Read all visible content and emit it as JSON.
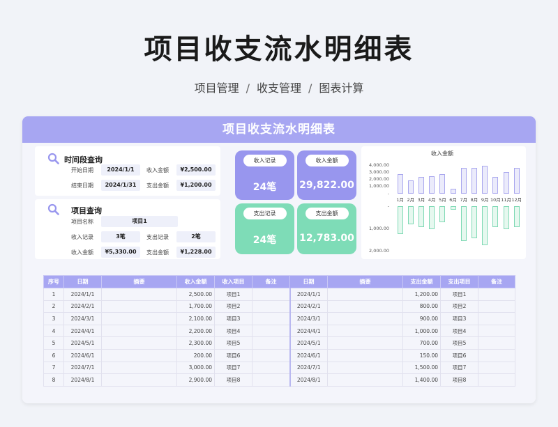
{
  "header": {
    "title": "项目收支流水明细表",
    "breadcrumb": [
      "项目管理",
      "收支管理",
      "图表计算"
    ]
  },
  "card_title": "项目收支流水明细表",
  "time_query": {
    "title": "时间段查询",
    "start_label": "开始日期",
    "start_value": "2024/1/1",
    "income_label": "收入金额",
    "income_value": "¥2,500.00",
    "end_label": "结束日期",
    "end_value": "2024/1/31",
    "expense_label": "支出金额",
    "expense_value": "¥1,200.00"
  },
  "project_query": {
    "title": "项目查询",
    "name_label": "项目名称",
    "name_value": "项目1",
    "income_records_label": "收入记录",
    "income_records_value": "3笔",
    "expense_records_label": "支出记录",
    "expense_records_value": "2笔",
    "income_amount_label": "收入金额",
    "income_amount_value": "¥5,330.00",
    "expense_amount_label": "支出金额",
    "expense_amount_value": "¥1,228.00"
  },
  "stats": {
    "income_records": {
      "label": "收入记录",
      "value": "24笔"
    },
    "income_amount": {
      "label": "收入金额",
      "value": "29,822.00"
    },
    "expense_records": {
      "label": "支出记录",
      "value": "24笔"
    },
    "expense_amount": {
      "label": "支出金额",
      "value": "12,783.00"
    }
  },
  "colors": {
    "accent": "#a7a6f2",
    "purple_card": "#9896ee",
    "green_card": "#7edcb7"
  },
  "chart_data": {
    "type": "bar",
    "title": "收入金额",
    "categories": [
      "1月",
      "2月",
      "3月",
      "4月",
      "5月",
      "6月",
      "7月",
      "8月",
      "9月",
      "10月",
      "11月",
      "12月"
    ],
    "series": [
      {
        "values": [
          2500,
          1700,
          2100,
          2200,
          2500,
          600,
          3300,
          3300,
          3600,
          2100,
          2800,
          3300
        ]
      },
      {
        "values": [
          -1200,
          -800,
          -900,
          -1000,
          -700,
          -150,
          -1500,
          -1400,
          -1700,
          -900,
          -1000,
          -900
        ]
      }
    ],
    "yticks_top": [
      "4,000.00",
      "3,000.00",
      "2,000.00",
      "1,000.00",
      "-"
    ],
    "yticks_bottom": [
      "-",
      "1,000.00",
      "2,000.00"
    ]
  },
  "table": {
    "headers": [
      "序号",
      "日期",
      "摘要",
      "收入金额",
      "收入项目",
      "备注",
      "日期",
      "摘要",
      "支出金额",
      "支出项目",
      "备注"
    ],
    "rows": [
      [
        "1",
        "2024/1/1",
        "",
        "2,500.00",
        "项目1",
        "",
        "2024/1/1",
        "",
        "1,200.00",
        "项目1",
        ""
      ],
      [
        "2",
        "2024/2/1",
        "",
        "1,700.00",
        "项目2",
        "",
        "2024/2/1",
        "",
        "800.00",
        "项目2",
        ""
      ],
      [
        "3",
        "2024/3/1",
        "",
        "2,100.00",
        "项目3",
        "",
        "2024/3/1",
        "",
        "900.00",
        "项目3",
        ""
      ],
      [
        "4",
        "2024/4/1",
        "",
        "2,200.00",
        "项目4",
        "",
        "2024/4/1",
        "",
        "1,000.00",
        "项目4",
        ""
      ],
      [
        "5",
        "2024/5/1",
        "",
        "2,300.00",
        "项目5",
        "",
        "2024/5/1",
        "",
        "700.00",
        "项目5",
        ""
      ],
      [
        "6",
        "2024/6/1",
        "",
        "200.00",
        "项目6",
        "",
        "2024/6/1",
        "",
        "150.00",
        "项目6",
        ""
      ],
      [
        "7",
        "2024/7/1",
        "",
        "3,000.00",
        "项目7",
        "",
        "2024/7/1",
        "",
        "1,500.00",
        "项目7",
        ""
      ],
      [
        "8",
        "2024/8/1",
        "",
        "2,900.00",
        "项目8",
        "",
        "2024/8/1",
        "",
        "1,400.00",
        "项目8",
        ""
      ]
    ]
  }
}
